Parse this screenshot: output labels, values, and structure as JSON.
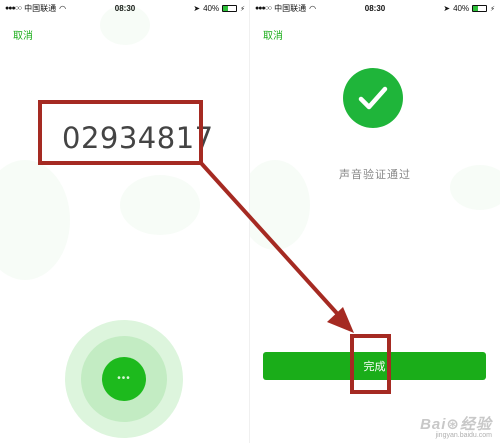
{
  "status_bar": {
    "carrier": "中国联通",
    "time": "08:30",
    "battery": "40%",
    "battery_fraction": 0.4,
    "signal_dots": "●●●○○"
  },
  "left_screen": {
    "cancel_label": "取消",
    "code": "02934817",
    "mic_dots": "•••"
  },
  "right_screen": {
    "cancel_label": "取消",
    "status_text": "声音验证通过",
    "done_label": "完成"
  },
  "colors": {
    "accent_green": "#1aad19",
    "annotation_red": "#a52a22"
  },
  "icons": {
    "wifi": "wifi-icon",
    "location": "location-arrow-icon",
    "battery": "battery-icon",
    "check": "checkmark-icon",
    "microphone": "microphone-button-icon"
  },
  "watermark": {
    "main": "Bai⊛经验",
    "sub": "jingyan.baidu.com"
  }
}
